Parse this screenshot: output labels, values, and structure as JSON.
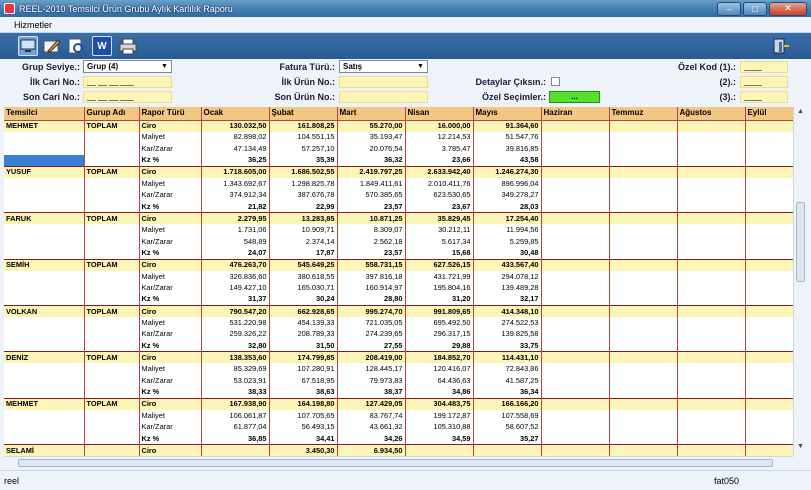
{
  "window": {
    "title": "REEL-2010 Temsilci Ürün Grubu Aylık Karlılık Raporu",
    "min": "–",
    "max": "□",
    "close": "✕"
  },
  "menu": {
    "hizmetler": "Hizmetler"
  },
  "toolbar": {
    "word_label": "W"
  },
  "filters": {
    "grup_seviye_label": "Grup Seviye.:",
    "grup_seviye_value": "Grup (4)",
    "ilk_cari_label": "İlk Cari No.:",
    "ilk_cari_value": "__ __ __ ___",
    "son_cari_label": "Son Cari No.:",
    "son_cari_value": "__ __ __ ___",
    "fatura_turu_label": "Fatura Türü.:",
    "fatura_turu_value": "Satış",
    "ilk_urun_label": "İlk Ürün No.:",
    "son_urun_label": "Son Ürün No.:",
    "detaylar_label": "Detaylar Çıksın.:",
    "ozel_secim_label": "Özel Seçimler.:",
    "ozel_secim_btn": "...",
    "ozel_kod1_label": "Özel Kod (1).:",
    "ozel_kod1_value": "____",
    "ozel_kod2_label": "(2).:",
    "ozel_kod2_value": "____",
    "ozel_kod3_label": "(3).:",
    "ozel_kod3_value": "____"
  },
  "grid": {
    "headers": [
      "Temsilci",
      "Gurup Adı",
      "Rapor Türü",
      "Ocak",
      "Şubat",
      "Mart",
      "Nisan",
      "Mayıs",
      "Haziran",
      "Temmuz",
      "Ağustos",
      "Eylül"
    ],
    "rows": [
      {
        "t": "ciro",
        "c": [
          "MEHMET",
          "TOPLAM",
          "Ciro",
          "130.032,50",
          "161.808,25",
          "55.270,00",
          "16.000,00",
          "91.364,60",
          "",
          "",
          "",
          ""
        ]
      },
      {
        "t": "n",
        "c": [
          "",
          "",
          "Maliyet",
          "82.898,02",
          "104.551,15",
          "35.193,47",
          "12.214,53",
          "51.547,76",
          "",
          "",
          "",
          ""
        ]
      },
      {
        "t": "n",
        "c": [
          "",
          "",
          "Kar/Zarar",
          "47.134,49",
          "57.257,10",
          "20.076,54",
          "3.785,47",
          "39.816,85",
          "",
          "",
          "",
          ""
        ]
      },
      {
        "t": "kz",
        "c": [
          "",
          "",
          "Kz %",
          "36,25",
          "35,39",
          "36,32",
          "23,66",
          "43,58",
          "",
          "",
          "",
          ""
        ]
      },
      {
        "t": "ciro",
        "c": [
          "YUSUF",
          "TOPLAM",
          "Ciro",
          "1.718.605,00",
          "1.686.502,55",
          "2.419.797,25",
          "2.633.942,40",
          "1.246.274,30",
          "",
          "",
          "",
          ""
        ]
      },
      {
        "t": "n",
        "c": [
          "",
          "",
          "Maliyet",
          "1.343.692,67",
          "1.298.825,78",
          "1.849.411,61",
          "2.010.411,76",
          "896.996,04",
          "",
          "",
          "",
          ""
        ]
      },
      {
        "t": "n",
        "c": [
          "",
          "",
          "Kar/Zarar",
          "374.912,34",
          "387.676,78",
          "570.385,65",
          "623.530,65",
          "349.278,27",
          "",
          "",
          "",
          ""
        ]
      },
      {
        "t": "kz",
        "c": [
          "",
          "",
          "Kz %",
          "21,82",
          "22,99",
          "23,57",
          "23,67",
          "28,03",
          "",
          "",
          "",
          ""
        ]
      },
      {
        "t": "ciro",
        "c": [
          "FARUK",
          "TOPLAM",
          "Ciro",
          "2.279,95",
          "13.283,85",
          "10.871,25",
          "35.829,45",
          "17.254,40",
          "",
          "",
          "",
          ""
        ]
      },
      {
        "t": "n",
        "c": [
          "",
          "",
          "Maliyet",
          "1.731,06",
          "10.909,71",
          "8.309,07",
          "30.212,11",
          "11.994,56",
          "",
          "",
          "",
          ""
        ]
      },
      {
        "t": "n",
        "c": [
          "",
          "",
          "Kar/Zarar",
          "548,89",
          "2.374,14",
          "2.562,18",
          "5.617,34",
          "5.259,85",
          "",
          "",
          "",
          ""
        ]
      },
      {
        "t": "kz",
        "c": [
          "",
          "",
          "Kz %",
          "24,07",
          "17,87",
          "23,57",
          "15,68",
          "30,48",
          "",
          "",
          "",
          ""
        ]
      },
      {
        "t": "ciro",
        "c": [
          "SEMİH",
          "TOPLAM",
          "Ciro",
          "476.263,70",
          "545.649,25",
          "558.731,15",
          "627.526,15",
          "433.567,40",
          "",
          "",
          "",
          ""
        ]
      },
      {
        "t": "n",
        "c": [
          "",
          "",
          "Maliyet",
          "326.836,60",
          "380.618,55",
          "397.816,18",
          "431.721,99",
          "294.078,12",
          "",
          "",
          "",
          ""
        ]
      },
      {
        "t": "n",
        "c": [
          "",
          "",
          "Kar/Zarar",
          "149.427,10",
          "165.030,71",
          "160.914,97",
          "195.804,16",
          "139.489,28",
          "",
          "",
          "",
          ""
        ]
      },
      {
        "t": "kz",
        "c": [
          "",
          "",
          "Kz %",
          "31,37",
          "30,24",
          "28,80",
          "31,20",
          "32,17",
          "",
          "",
          "",
          ""
        ]
      },
      {
        "t": "ciro",
        "c": [
          "VOLKAN",
          "TOPLAM",
          "Ciro",
          "790.547,20",
          "662.928,65",
          "995.274,70",
          "991.809,65",
          "414.348,10",
          "",
          "",
          "",
          ""
        ]
      },
      {
        "t": "n",
        "c": [
          "",
          "",
          "Maliyet",
          "531.220,98",
          "454.139,33",
          "721.035,05",
          "695.492,50",
          "274.522,53",
          "",
          "",
          "",
          ""
        ]
      },
      {
        "t": "n",
        "c": [
          "",
          "",
          "Kar/Zarar",
          "259.326,22",
          "208.789,33",
          "274.239,65",
          "296.317,15",
          "139.825,58",
          "",
          "",
          "",
          ""
        ]
      },
      {
        "t": "kz",
        "c": [
          "",
          "",
          "Kz %",
          "32,80",
          "31,50",
          "27,55",
          "29,88",
          "33,75",
          "",
          "",
          "",
          ""
        ]
      },
      {
        "t": "ciro",
        "c": [
          "DENİZ",
          "TOPLAM",
          "Ciro",
          "138.353,60",
          "174.799,85",
          "208.419,00",
          "184.852,70",
          "114.431,10",
          "",
          "",
          "",
          ""
        ]
      },
      {
        "t": "n",
        "c": [
          "",
          "",
          "Maliyet",
          "85.329,69",
          "107.280,91",
          "128.445,17",
          "120.416,07",
          "72.843,86",
          "",
          "",
          "",
          ""
        ]
      },
      {
        "t": "n",
        "c": [
          "",
          "",
          "Kar/Zarar",
          "53.023,91",
          "67.518,95",
          "79.973,83",
          "64.436,63",
          "41.587,25",
          "",
          "",
          "",
          ""
        ]
      },
      {
        "t": "kz",
        "c": [
          "",
          "",
          "Kz %",
          "38,33",
          "38,63",
          "38,37",
          "34,86",
          "36,34",
          "",
          "",
          "",
          ""
        ]
      },
      {
        "t": "ciro",
        "c": [
          "MEHMET",
          "TOPLAM",
          "Ciro",
          "167.938,90",
          "164.198,80",
          "127.429,05",
          "304.483,75",
          "166.166,20",
          "",
          "",
          "",
          ""
        ]
      },
      {
        "t": "n",
        "c": [
          "",
          "",
          "Maliyet",
          "106.061,87",
          "107.705,65",
          "83.767,74",
          "199.172,87",
          "107.558,69",
          "",
          "",
          "",
          ""
        ]
      },
      {
        "t": "n",
        "c": [
          "",
          "",
          "Kar/Zarar",
          "61.877,04",
          "56.493,15",
          "43.661,32",
          "105.310,88",
          "58.607,52",
          "",
          "",
          "",
          ""
        ]
      },
      {
        "t": "kz",
        "c": [
          "",
          "",
          "Kz %",
          "36,85",
          "34,41",
          "34,26",
          "34,59",
          "35,27",
          "",
          "",
          "",
          ""
        ]
      },
      {
        "t": "ciro",
        "c": [
          "SELAMİ",
          "",
          "Ciro",
          "",
          "3.450,30",
          "6.934,50",
          "",
          "",
          "",
          "",
          "",
          ""
        ]
      },
      {
        "t": "n",
        "c": [
          "",
          "",
          "Maliyet",
          "",
          "2.822,47",
          "5.954,46",
          "",
          "",
          "",
          "",
          "",
          ""
        ]
      }
    ]
  },
  "status": {
    "left": "reel",
    "right": "fat050"
  }
}
